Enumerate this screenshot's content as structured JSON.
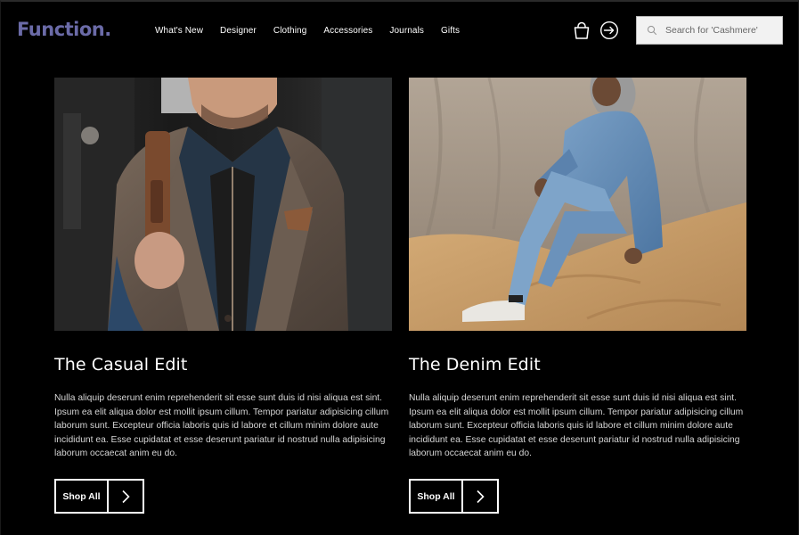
{
  "brand": {
    "logo": "Function."
  },
  "nav": {
    "items": [
      {
        "label": "What's New"
      },
      {
        "label": "Designer"
      },
      {
        "label": "Clothing"
      },
      {
        "label": "Accessories"
      },
      {
        "label": "Journals"
      },
      {
        "label": "Gifts"
      }
    ]
  },
  "header": {
    "icons": {
      "bag": "shopping-bag-icon",
      "login": "login-arrow-icon",
      "search": "search-icon"
    },
    "search_placeholder": "Search for 'Cashmere'"
  },
  "colors": {
    "brand": "#6b6ba8",
    "background": "#000000",
    "text": "#ffffff",
    "body_text": "#d6d6d6"
  },
  "cards": [
    {
      "title": "The Casual Edit",
      "body": "Nulla aliquip deserunt enim reprehenderit sit esse sunt duis id nisi aliqua est sint. Ipsum ea elit aliqua dolor est mollit ipsum cillum. Tempor pariatur adipisicing cillum laborum sunt. Excepteur officia laboris quis id labore et cillum minim dolore aute incididunt ea. Esse cupidatat et esse deserunt pariatur id nostrud nulla adipisicing laborum occaecat anim eu do.",
      "button": "Shop All"
    },
    {
      "title": "The Denim Edit",
      "body": "Nulla aliquip deserunt enim reprehenderit sit esse sunt duis id nisi aliqua est sint. Ipsum ea elit aliqua dolor est mollit ipsum cillum. Tempor pariatur adipisicing cillum laborum sunt. Excepteur officia laboris quis id labore et cillum minim dolore aute incididunt ea. Esse cupidatat et esse deserunt pariatur id nostrud nulla adipisicing laborum occaecat anim eu do.",
      "button": "Shop All"
    }
  ]
}
